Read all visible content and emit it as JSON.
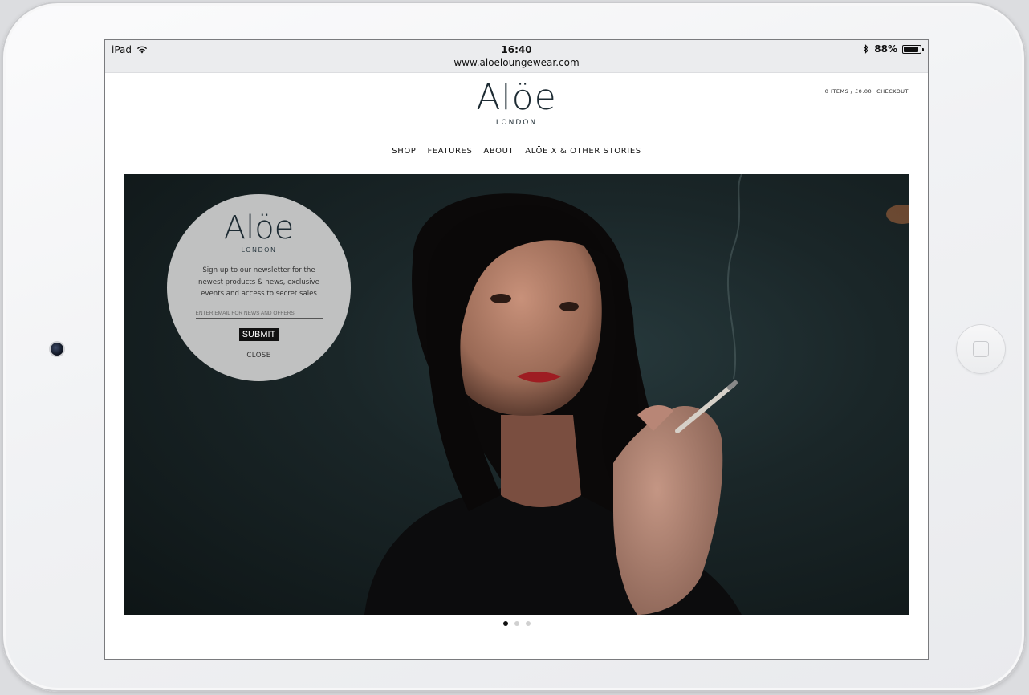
{
  "statusbar": {
    "device": "iPad",
    "time": "16:40",
    "url": "www.aloeloungewear.com",
    "battery": "88%",
    "battery_level": 0.88
  },
  "header": {
    "logo": "Alöe",
    "logo_sub": "LONDON",
    "cart_summary": "0 ITEMS / £0.00",
    "checkout": "CHECKOUT"
  },
  "nav": {
    "items": [
      "SHOP",
      "FEATURES",
      "ABOUT",
      "ALÖE X & OTHER STORIES"
    ]
  },
  "popup": {
    "logo": "Alöe",
    "logo_sub": "LONDON",
    "message": "Sign up to our newsletter for the newest products & news, exclusive events and access to secret sales",
    "email_placeholder": "ENTER EMAIL FOR NEWS AND OFFERS",
    "submit": "SUBMIT",
    "close": "CLOSE"
  },
  "carousel": {
    "slide_count": 3,
    "active_index": 0
  },
  "colors": {
    "brand": "#1d2b33",
    "hero_background": "#1a2628"
  }
}
